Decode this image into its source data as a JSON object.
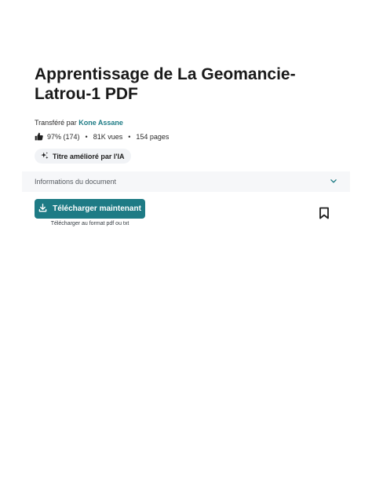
{
  "document": {
    "title": "Apprentissage de La Geomancie-Latrou-1 PDF",
    "uploaded_by_label": "Transféré par",
    "uploader_name": "Kone Assane",
    "rating": "97% (174)",
    "views": "81K vues",
    "pages": "154 pages"
  },
  "ai_chip": {
    "label": "Titre amélioré par l'IA"
  },
  "info_bar": {
    "label": "Informations du document"
  },
  "download": {
    "button_label": "Télécharger maintenant",
    "subtext": "Télécharger au format pdf ou txt"
  },
  "colors": {
    "accent": "#1e7b85",
    "chip_bg": "#f1f3f6",
    "info_bg": "#f6f7f9"
  },
  "icons": [
    "thumbs-up-icon",
    "sparkle-icon",
    "chevron-down-icon",
    "download-icon",
    "bookmark-icon"
  ]
}
